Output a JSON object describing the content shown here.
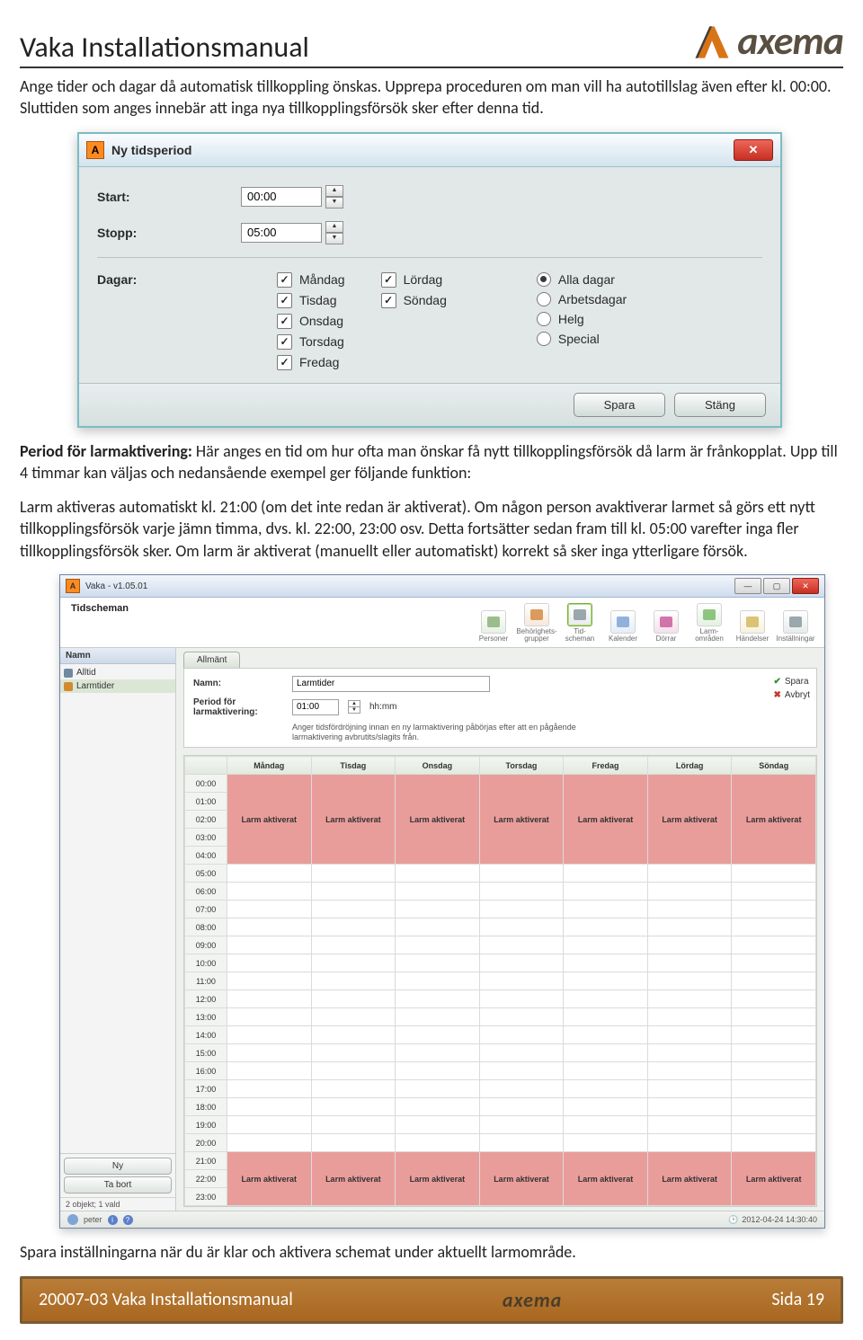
{
  "page_title": "Vaka Installationsmanual",
  "logo_text": "axema",
  "intro_paragraph": "Ange tider och dagar då automatisk tillkoppling önskas. Upprepa proceduren om man vill ha autotillslag även efter kl. 00:00. Sluttiden som anges innebär att inga nya tillkopplingsförsök sker efter denna tid.",
  "dialog1": {
    "title": "Ny tidsperiod",
    "start_label": "Start:",
    "start_value": "00:00",
    "stop_label": "Stopp:",
    "stop_value": "05:00",
    "days_label": "Dagar:",
    "weekdays_col1": [
      "Måndag",
      "Tisdag",
      "Onsdag",
      "Torsdag",
      "Fredag"
    ],
    "weekdays_col2": [
      "Lördag",
      "Söndag"
    ],
    "radios": [
      "Alla dagar",
      "Arbetsdagar",
      "Helg",
      "Special"
    ],
    "radio_selected": "Alla dagar",
    "save_label": "Spara",
    "close_label": "Stäng"
  },
  "mid_para1_bold": "Period för larmaktivering:",
  "mid_para1_rest": " Här anges en tid om hur ofta man önskar få nytt tillkopplingsförsök då larm är frånkopplat. Upp till 4 timmar kan väljas och nedansående exempel ger följande funktion:",
  "mid_para2": "Larm aktiveras automatiskt kl. 21:00 (om det inte redan är aktiverat). Om någon person avaktiverar larmet så görs ett nytt tillkopplingsförsök varje jämn timma, dvs. kl. 22:00, 23:00 osv. Detta fortsätter sedan fram till kl. 05:00 varefter inga fler tillkopplingsförsök sker. Om larm är aktiverat (manuellt eller automatiskt) korrekt så sker inga ytterligare försök.",
  "app": {
    "window_title": "Vaka - v1.05.01",
    "section_title": "Tidscheman",
    "tools": [
      {
        "label": "Personer"
      },
      {
        "label": "Behörighets-\ngrupper"
      },
      {
        "label": "Tid-\nscheman",
        "active": true
      },
      {
        "label": "Kalender"
      },
      {
        "label": "Dörrar"
      },
      {
        "label": "Larm-\nområden"
      },
      {
        "label": "Händelser"
      },
      {
        "label": "Inställningar"
      }
    ],
    "sidebar_header": "Namn",
    "tree_items": [
      {
        "name": "Alltid",
        "sel": false,
        "kind": "alltid"
      },
      {
        "name": "Larmtider",
        "sel": true,
        "kind": "larm"
      }
    ],
    "new_btn": "Ny",
    "del_btn": "Ta bort",
    "count_text": "2 objekt; 1 vald",
    "tab": "Allmänt",
    "form": {
      "name_label": "Namn:",
      "name_value": "Larmtider",
      "period_label": "Period för larmaktivering:",
      "period_value": "01:00",
      "period_unit": "hh:mm",
      "hint": "Anger tidsfördröjning innan en ny larmaktivering påbörjas efter att en pågående larmaktivering avbrutits/slagits från.",
      "save": "Spara",
      "cancel": "Avbryt"
    },
    "grid": {
      "days": [
        "Måndag",
        "Tisdag",
        "Onsdag",
        "Torsdag",
        "Fredag",
        "Lördag",
        "Söndag"
      ],
      "hours": [
        "00:00",
        "01:00",
        "02:00",
        "03:00",
        "04:00",
        "05:00",
        "06:00",
        "07:00",
        "08:00",
        "09:00",
        "10:00",
        "11:00",
        "12:00",
        "13:00",
        "14:00",
        "15:00",
        "16:00",
        "17:00",
        "18:00",
        "19:00",
        "20:00",
        "21:00",
        "22:00",
        "23:00"
      ],
      "alarm_text": "Larm aktiverat",
      "alarm_rows_top": [
        "00:00",
        "01:00",
        "02:00",
        "03:00",
        "04:00"
      ],
      "alarm_rows_bottom": [
        "21:00",
        "22:00",
        "23:00"
      ]
    },
    "status_user": "peter",
    "status_time": "2012-04-24 14:30:40"
  },
  "final_para": "Spara inställningarna när du är klar och aktivera schemat under aktuellt larmområde.",
  "footer": {
    "doc": "20007-03 Vaka Installationsmanual",
    "logo": "axema",
    "page": "Sida 19"
  }
}
